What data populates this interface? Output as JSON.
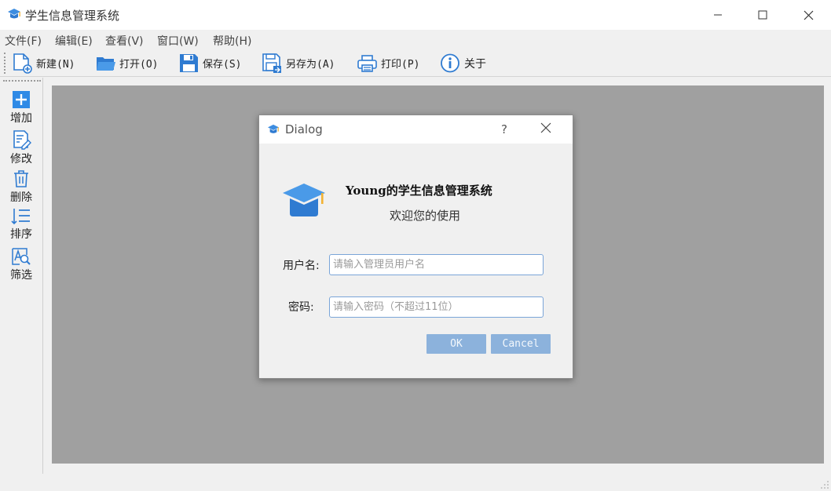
{
  "window": {
    "title": "学生信息管理系统"
  },
  "menu": [
    {
      "label": "文件(F)"
    },
    {
      "label": "编辑(E)"
    },
    {
      "label": "查看(V)"
    },
    {
      "label": "窗口(W)"
    },
    {
      "label": "帮助(H)"
    }
  ],
  "toolbar": [
    {
      "label": "新建(N)",
      "icon": "new-file-icon"
    },
    {
      "label": "打开(O)",
      "icon": "open-folder-icon"
    },
    {
      "label": "保存(S)",
      "icon": "save-icon"
    },
    {
      "label": "另存为(A)",
      "icon": "save-as-icon"
    },
    {
      "label": "打印(P)",
      "icon": "print-icon"
    },
    {
      "label": "关于",
      "icon": "info-icon"
    }
  ],
  "sidebar": [
    {
      "label": "增加",
      "icon": "add-icon"
    },
    {
      "label": "修改",
      "icon": "edit-icon"
    },
    {
      "label": "删除",
      "icon": "delete-icon"
    },
    {
      "label": "排序",
      "icon": "sort-icon"
    },
    {
      "label": "筛选",
      "icon": "filter-icon"
    }
  ],
  "dialog": {
    "title": "Dialog",
    "help": "?",
    "heading": "Young的学生信息管理系统",
    "subheading": "欢迎您的使用",
    "username_label": "用户名:",
    "username_placeholder": "请输入管理员用户名",
    "password_label": "密码:",
    "password_placeholder": "请输入密码（不超过11位）",
    "ok_label": "OK",
    "cancel_label": "Cancel"
  },
  "colors": {
    "accent": "#3d8de0",
    "workspace": "#a0a0a0",
    "dialog_button": "#8cb2dc",
    "input_border": "#7aa5d8"
  }
}
